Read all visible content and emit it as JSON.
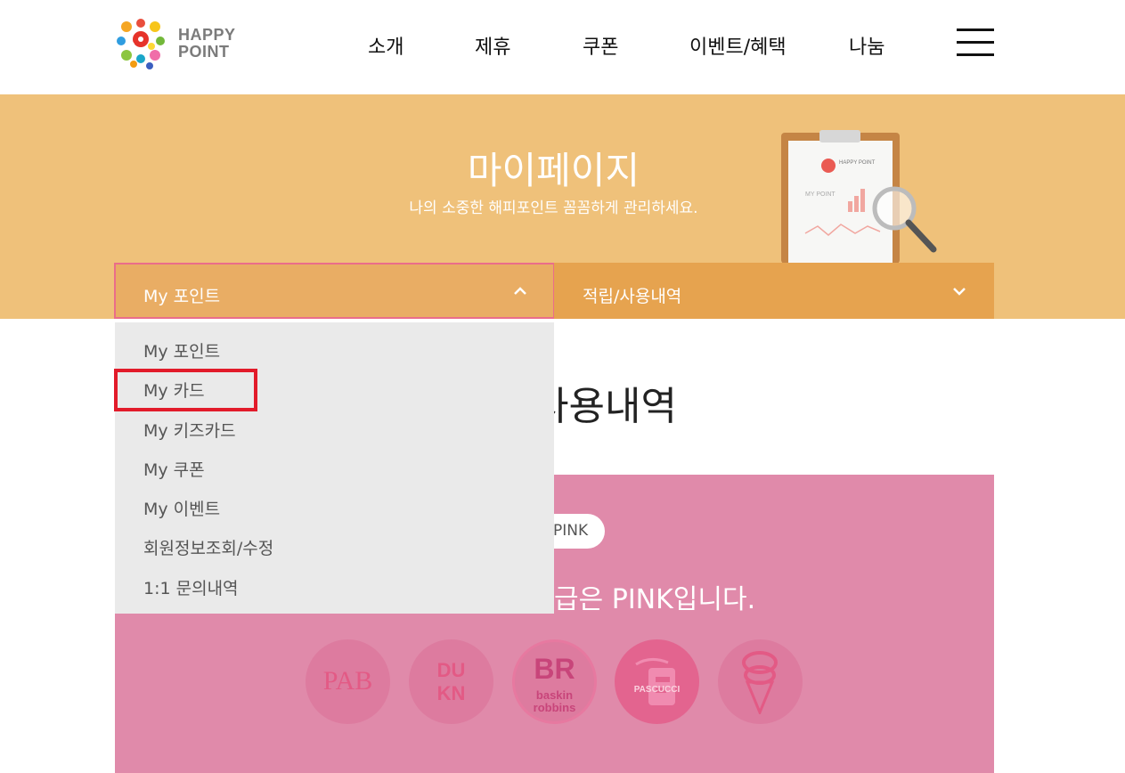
{
  "header": {
    "logo_line1": "HAPPY",
    "logo_line2": "POINT",
    "nav": [
      "소개",
      "제휴",
      "쿠폰",
      "이벤트/혜택",
      "나눔"
    ]
  },
  "banner": {
    "title": "마이페이지",
    "subtitle": "나의 소중한 해피포인트 꼼꼼하게 관리하세요.",
    "clipboard_logo": "HAPPY POINT",
    "clipboard_label": "MY POINT"
  },
  "dropdowns": {
    "primary_label": "My 포인트",
    "secondary_label": "적립/사용내역"
  },
  "menu": {
    "items": [
      "My 포인트",
      "My 카드",
      "My 키즈카드",
      "My 쿠폰",
      "My 이벤트",
      "회원정보조회/수정",
      "1:1 문의내역"
    ]
  },
  "main": {
    "title_fragment": "사용내역",
    "grade_badge": "PINK",
    "grade_text": "급은 PINK입니다."
  },
  "brands": {
    "paris_baguette": "PAB",
    "dunkin_line1": "DU",
    "dunkin_line2": "KN",
    "baskin_br": "BR",
    "baskin_line1": "baskin",
    "baskin_line2": "robbins",
    "pascucci": "PASCUCCI"
  },
  "colors": {
    "banner": "#efc17a",
    "bar_left": "#e9ad64",
    "bar_right": "#e6a34f",
    "pink_panel": "#e08aaa",
    "highlight": "#e21b2a"
  }
}
